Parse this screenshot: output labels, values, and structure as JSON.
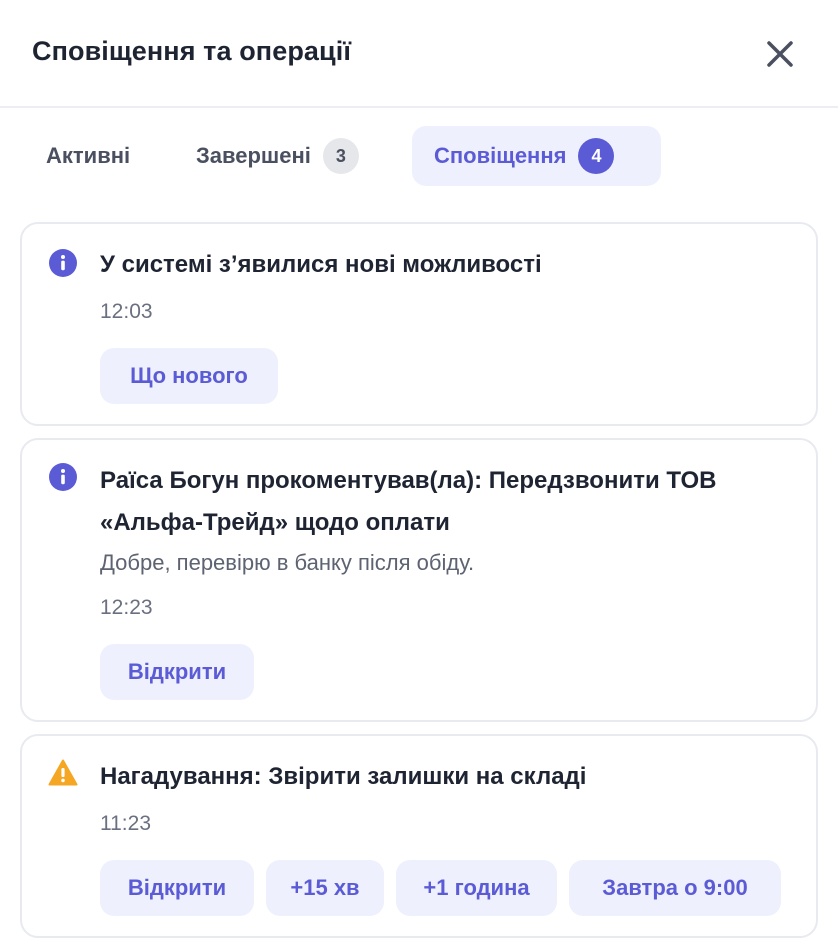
{
  "header": {
    "title": "Сповіщення та операції",
    "close_icon": "close-icon"
  },
  "tabs": [
    {
      "label": "Активні",
      "count": null,
      "active": false
    },
    {
      "label": "Завершені",
      "count": "3",
      "active": false
    },
    {
      "label": "Сповіщення",
      "count": "4",
      "active": true
    }
  ],
  "notifications": [
    {
      "icon": "info-icon",
      "title": "У системі з’явилися нові можливості",
      "time": "12:03",
      "actions": [
        "Що нового"
      ]
    },
    {
      "icon": "info-icon",
      "title_line1": "Раїса Богун прокоментував(ла): Передзвонити ТОВ",
      "title_line2": "«Альфа-Трейд» щодо оплати",
      "subtitle": "Добре, перевірю в банку після обіду.",
      "time": "12:23",
      "actions": [
        "Відкрити"
      ]
    },
    {
      "icon": "warning-icon",
      "title": "Нагадування: Звірити залишки на складі",
      "time": "11:23",
      "actions": [
        "Відкрити",
        "+15 хв",
        "+1 година",
        "Завтра о 9:00"
      ]
    }
  ],
  "colors": {
    "accent": "#5b5bd6",
    "accent_bg": "#eef0fd",
    "info": "#5b5bd6",
    "warning": "#f5a623",
    "border": "#e8eaef"
  }
}
